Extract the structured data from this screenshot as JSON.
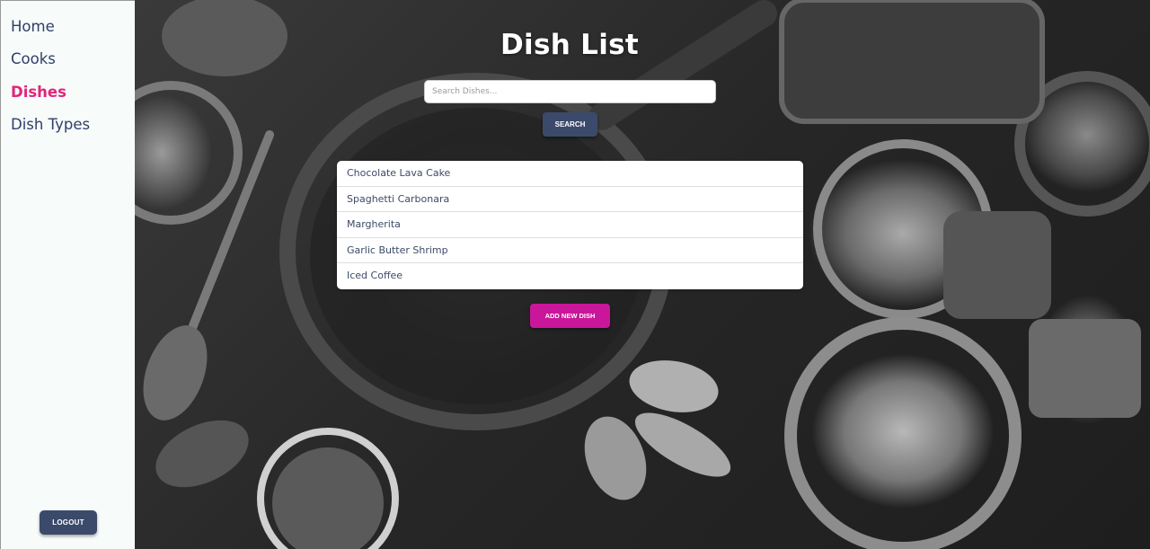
{
  "sidebar": {
    "items": [
      {
        "label": "Home"
      },
      {
        "label": "Cooks"
      },
      {
        "label": "Dishes"
      },
      {
        "label": "Dish Types"
      }
    ],
    "logout_label": "LOGOUT"
  },
  "main": {
    "title": "Dish List",
    "search": {
      "placeholder": "Search Dishes...",
      "value": "",
      "button_label": "SEARCH"
    },
    "dishes": [
      "Chocolate Lava Cake",
      "Spaghetti Carbonara",
      "Margherita",
      "Garlic Butter Shrimp",
      "Iced Coffee"
    ],
    "add_button_label": "ADD NEW DISH"
  },
  "colors": {
    "nav_text": "#2f3e6b",
    "nav_active": "#e0267c",
    "primary_button": "#3b4a6b",
    "accent_button": "#c9169a"
  }
}
